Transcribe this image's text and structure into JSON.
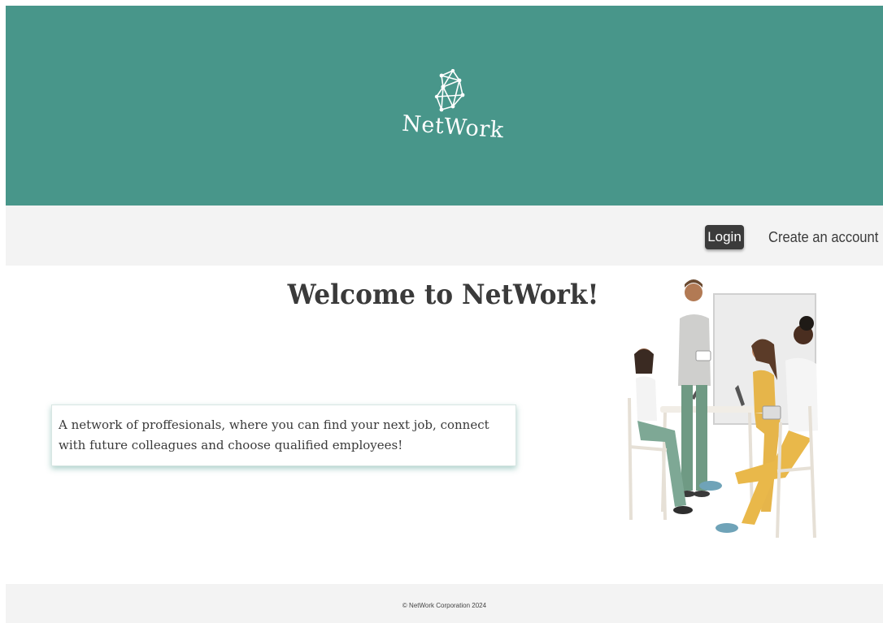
{
  "header": {
    "brand": "NetWork",
    "logo_icon": "network-nodes-icon",
    "background_color": "#48968a"
  },
  "nav": {
    "login_label": "Login",
    "create_account_label": "Create an account"
  },
  "main": {
    "welcome_title": "Welcome to NetWork!",
    "intro_text": "A network of proffesionals, where you can find your next job, connect with future colleagues and choose qualified employees!",
    "illustration": "team-meeting-illustration"
  },
  "footer": {
    "copyright": "© NetWork Corporation 2024"
  },
  "colors": {
    "accent": "#48968a",
    "button_dark": "#3b3b3b",
    "nav_bg": "#f3f3f3"
  }
}
